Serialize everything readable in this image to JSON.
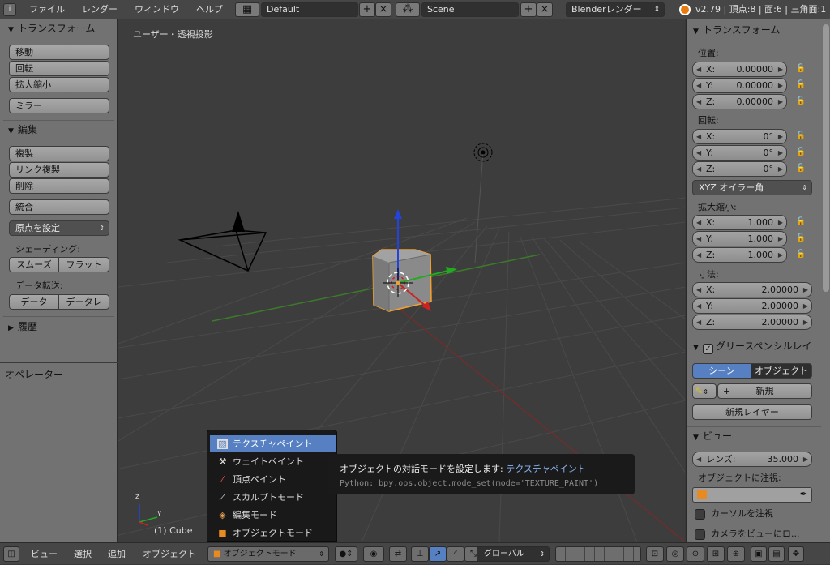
{
  "topbar": {
    "menus": [
      "ファイル",
      "レンダー",
      "ウィンドウ",
      "ヘルプ"
    ],
    "screen_layout": "Default",
    "scene": "Scene",
    "render_engine": "Blenderレンダー",
    "stats": "v2.79 | 頂点:8 | 面:6 | 三角面:1"
  },
  "left_panel": {
    "transform_header": "トランスフォーム",
    "translate": "移動",
    "rotate": "回転",
    "scale": "拡大縮小",
    "mirror": "ミラー",
    "edit_header": "編集",
    "duplicate": "複製",
    "duplicate_linked": "リンク複製",
    "delete": "削除",
    "join": "統合",
    "set_origin": "原点を設定",
    "shading_label": "シェーディング:",
    "smooth": "スムーズ",
    "flat": "フラット",
    "data_transfer_label": "データ転送:",
    "data": "データ",
    "data_layout": "データレ",
    "history_header": "履歴",
    "operator_header": "オペレーター"
  },
  "viewport": {
    "label": "ユーザー・透視投影",
    "object_label": "(1) Cube",
    "axis_z": "z",
    "axis_y": "y"
  },
  "right_panel": {
    "transform_header": "トランスフォーム",
    "location_label": "位置:",
    "location": [
      {
        "axis": "X:",
        "value": "0.00000"
      },
      {
        "axis": "Y:",
        "value": "0.00000"
      },
      {
        "axis": "Z:",
        "value": "0.00000"
      }
    ],
    "rotation_label": "回転:",
    "rotation": [
      {
        "axis": "X:",
        "value": "0°"
      },
      {
        "axis": "Y:",
        "value": "0°"
      },
      {
        "axis": "Z:",
        "value": "0°"
      }
    ],
    "rotation_mode": "XYZ オイラー角",
    "scale_label": "拡大縮小:",
    "scale": [
      {
        "axis": "X:",
        "value": "1.000"
      },
      {
        "axis": "Y:",
        "value": "1.000"
      },
      {
        "axis": "Z:",
        "value": "1.000"
      }
    ],
    "dimensions_label": "寸法:",
    "dimensions": [
      {
        "axis": "X:",
        "value": "2.00000"
      },
      {
        "axis": "Y:",
        "value": "2.00000"
      },
      {
        "axis": "Z:",
        "value": "2.00000"
      }
    ],
    "grease_header": "グリースペンシルレイ",
    "scene_tab": "シーン",
    "object_tab": "オブジェクト",
    "new_label": "新規",
    "new_layer": "新規レイヤー",
    "view_header": "ビュー",
    "lens_label": "レンズ:",
    "lens_value": "35.000",
    "lock_object_label": "オブジェクトに注視:",
    "lock_cursor": "カーソルを注視",
    "lock_camera": "カメラをビューにロ..."
  },
  "mode_popup": {
    "items": [
      {
        "label": "テクスチャペイント",
        "icon": "texture-paint-icon",
        "active": true
      },
      {
        "label": "ウェイトペイント",
        "icon": "weight-paint-icon",
        "active": false
      },
      {
        "label": "頂点ペイント",
        "icon": "vertex-paint-icon",
        "active": false
      },
      {
        "label": "スカルプトモード",
        "icon": "sculpt-icon",
        "active": false
      },
      {
        "label": "編集モード",
        "icon": "edit-mode-icon",
        "active": false
      },
      {
        "label": "オブジェクトモード",
        "icon": "object-mode-icon",
        "active": false
      }
    ]
  },
  "tooltip": {
    "title": "オブジェクトの対話モードを設定します:",
    "value": "テクスチャペイント",
    "python": "Python: bpy.ops.object.mode_set(mode='TEXTURE_PAINT')"
  },
  "bottombar": {
    "menus": [
      "ビュー",
      "選択",
      "追加",
      "オブジェクト"
    ],
    "mode": "オブジェクトモード",
    "orientation": "グローバル"
  },
  "colors": {
    "accent": "#5680c2",
    "selected_outline": "#f0a030",
    "axis_x": "#cc2222",
    "axis_y": "#22aa22",
    "axis_z": "#2244dd"
  }
}
